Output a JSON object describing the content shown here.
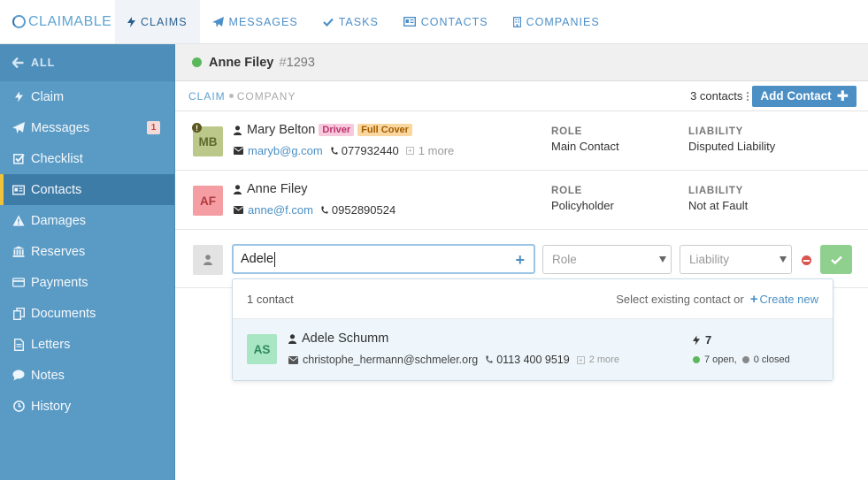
{
  "app": {
    "logo_prefix": "CLAIM",
    "logo_suffix": "ABLE"
  },
  "nav": {
    "tabs": [
      {
        "label": "CLAIMS",
        "icon": "bolt-icon",
        "active": true
      },
      {
        "label": "MESSAGES",
        "icon": "paper-plane-icon"
      },
      {
        "label": "TASKS",
        "icon": "check-icon"
      },
      {
        "label": "CONTACTS",
        "icon": "id-card-icon"
      },
      {
        "label": "COMPANIES",
        "icon": "building-icon"
      }
    ]
  },
  "sidebar": {
    "back_label": "ALL",
    "items": [
      {
        "label": "Claim",
        "icon": "bolt-icon"
      },
      {
        "label": "Messages",
        "icon": "paper-plane-icon",
        "badge": "1"
      },
      {
        "label": "Checklist",
        "icon": "checkbox-icon"
      },
      {
        "label": "Contacts",
        "icon": "id-card-icon",
        "active": true
      },
      {
        "label": "Damages",
        "icon": "warning-icon"
      },
      {
        "label": "Reserves",
        "icon": "bank-icon"
      },
      {
        "label": "Payments",
        "icon": "credit-card-icon"
      },
      {
        "label": "Documents",
        "icon": "copy-icon"
      },
      {
        "label": "Letters",
        "icon": "file-icon"
      },
      {
        "label": "Notes",
        "icon": "comment-icon"
      },
      {
        "label": "History",
        "icon": "clock-icon"
      }
    ]
  },
  "claim": {
    "name": "Anne Filey",
    "hash": "#",
    "number": "1293",
    "status_color": "#5cb85c"
  },
  "subnav": {
    "crumb_active": "CLAIM",
    "crumb_inactive": "COMPANY",
    "contact_count": "3 contacts",
    "add_contact_label": "Add Contact"
  },
  "contacts": [
    {
      "initials": "MB",
      "name": "Mary Belton",
      "tags": [
        "Driver",
        "Full Cover"
      ],
      "email": "maryb@g.com",
      "phone": "077932440",
      "more": "1 more",
      "role_label": "ROLE",
      "role": "Main Contact",
      "liability_label": "LIABILITY",
      "liability": "Disputed Liability",
      "alert": "!"
    },
    {
      "initials": "AF",
      "name": "Anne Filey",
      "email": "anne@f.com",
      "phone": "0952890524",
      "role_label": "ROLE",
      "role": "Policyholder",
      "liability_label": "LIABILITY",
      "liability": "Not at Fault"
    }
  ],
  "new_contact": {
    "name_value": "Adele",
    "role_placeholder": "Role",
    "liability_placeholder": "Liability"
  },
  "dropdown": {
    "count": "1 contact",
    "hint": "Select existing contact or",
    "create_label": "Create new",
    "results": [
      {
        "initials": "AS",
        "name": "Adele Schumm",
        "email": "christophe_hermann@schmeler.org",
        "phone": "0113 400 9519",
        "more": "2 more",
        "claims": "7",
        "open": "7 open,",
        "closed": "0 closed"
      }
    ]
  }
}
